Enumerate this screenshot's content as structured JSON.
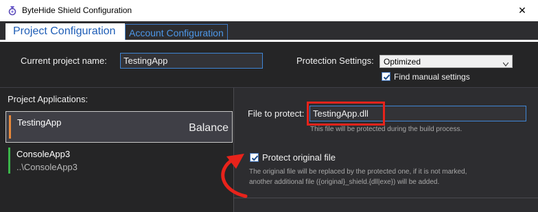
{
  "window": {
    "title": "ByteHide Shield Configuration",
    "close_glyph": "✕"
  },
  "tabs": [
    {
      "label": "Project Configuration",
      "active": true
    },
    {
      "label": "Account Configuration",
      "active": false
    }
  ],
  "project": {
    "name_label": "Current project name:",
    "name_value": "TestingApp",
    "protection_label": "Protection Settings:",
    "protection_value": "Optimized",
    "find_manual_label": "Find manual settings",
    "find_manual_checked": true
  },
  "applications": {
    "header": "Project Applications:",
    "items": [
      {
        "name": "TestingApp",
        "level": "Balance",
        "accent_color": "#e8893a",
        "selected": true
      },
      {
        "name": "ConsoleApp3",
        "path": "..\\ConsoleApp3",
        "accent_color": "#3bb54a",
        "selected": false
      }
    ]
  },
  "details": {
    "file_label": "File to protect:",
    "file_value": "TestingApp.dll",
    "file_hint": "This file will be protected during the build process.",
    "protect_original_label": "Protect original file",
    "protect_original_checked": true,
    "protect_hint_line1": "The original file will be replaced by the protected one, if it is not marked,",
    "protect_hint_line2": "another additional file ({original}_shield.{dll|exe}) will be added."
  },
  "colors": {
    "accent_blue": "#3f86d6",
    "annotation_red": "#e8231b",
    "panel_dark": "#252526",
    "panel_mid": "#2d2d30"
  }
}
